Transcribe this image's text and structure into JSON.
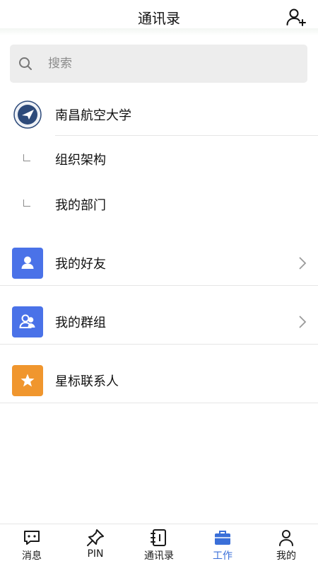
{
  "header": {
    "title": "通讯录",
    "add_icon": "add-contact-icon"
  },
  "search": {
    "placeholder": "搜索",
    "icon": "search-icon"
  },
  "organization": {
    "name": "南昌航空大学"
  },
  "org_sub_items": [
    {
      "label": "组织架构"
    },
    {
      "label": "我的部门"
    }
  ],
  "groups": [
    {
      "label": "我的好友",
      "icon": "person-icon",
      "color": "#4a72e8",
      "has_chevron": true
    },
    {
      "label": "我的群组",
      "icon": "group-icon",
      "color": "#4a72e8",
      "has_chevron": true
    },
    {
      "label": "星标联系人",
      "icon": "star-icon",
      "color": "#f0962e",
      "has_chevron": false
    }
  ],
  "tabbar": {
    "tabs": [
      {
        "label": "消息",
        "icon": "chat-icon"
      },
      {
        "label": "PIN",
        "icon": "pin-icon"
      },
      {
        "label": "通讯录",
        "icon": "contacts-book-icon"
      },
      {
        "label": "工作",
        "icon": "briefcase-icon",
        "active": true
      },
      {
        "label": "我的",
        "icon": "profile-icon"
      }
    ]
  },
  "colors": {
    "accent": "#3a6fd8",
    "friend_badge": "#4a72e8",
    "star_badge": "#f0962e"
  }
}
